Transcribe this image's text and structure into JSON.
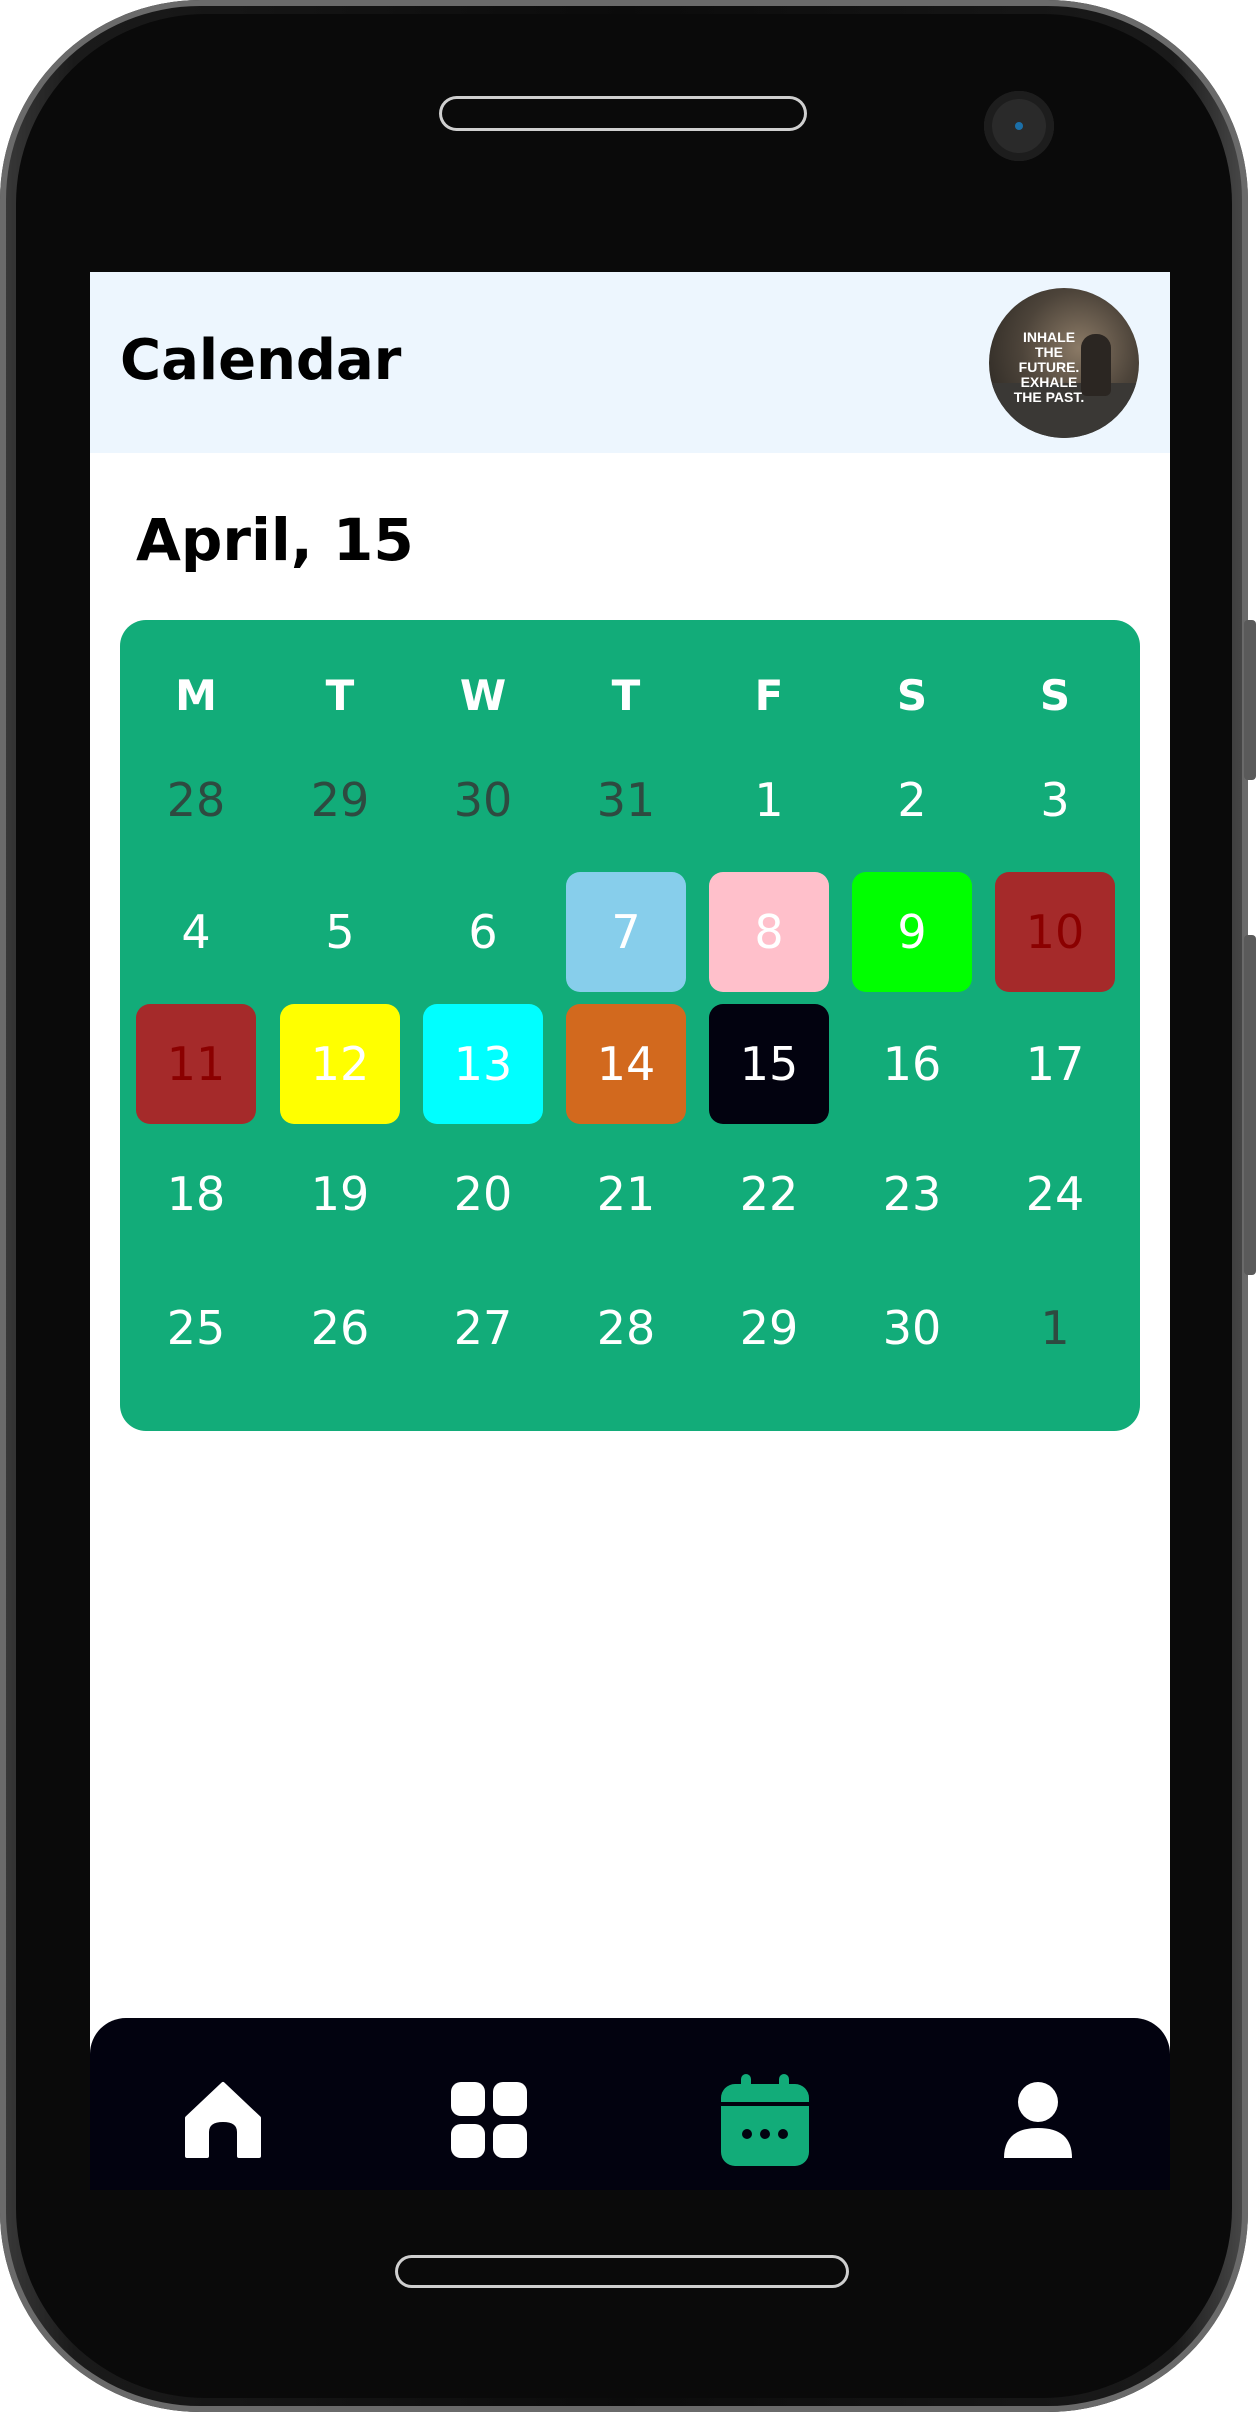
{
  "header": {
    "title": "Calendar",
    "avatar_text": [
      "INHALE",
      "THE FUTURE.",
      "EXHALE",
      "THE PAST."
    ]
  },
  "date_heading": "April, 15",
  "calendar": {
    "weekdays": [
      "M",
      "T",
      "W",
      "T",
      "F",
      "S",
      "S"
    ],
    "accent": "#12ac79",
    "weeks": [
      [
        {
          "d": "28",
          "muted": true
        },
        {
          "d": "29",
          "muted": true
        },
        {
          "d": "30",
          "muted": true
        },
        {
          "d": "31",
          "muted": true
        },
        {
          "d": "1"
        },
        {
          "d": "2"
        },
        {
          "d": "3"
        }
      ],
      [
        {
          "d": "4"
        },
        {
          "d": "5"
        },
        {
          "d": "6"
        },
        {
          "d": "7",
          "bg": "#87ceeb"
        },
        {
          "d": "8",
          "bg": "#ffc0cb"
        },
        {
          "d": "9",
          "bg": "#00ff00"
        },
        {
          "d": "10",
          "bg": "#a52a2a",
          "fg": "#8b0000"
        }
      ],
      [
        {
          "d": "11",
          "bg": "#a52a2a",
          "fg": "#8b0000"
        },
        {
          "d": "12",
          "bg": "#ffff00"
        },
        {
          "d": "13",
          "bg": "#00ffff"
        },
        {
          "d": "14",
          "bg": "#d2691e"
        },
        {
          "d": "15",
          "bg": "#02020f",
          "selected": true
        },
        {
          "d": "16"
        },
        {
          "d": "17"
        }
      ],
      [
        {
          "d": "18"
        },
        {
          "d": "19"
        },
        {
          "d": "20"
        },
        {
          "d": "21"
        },
        {
          "d": "22"
        },
        {
          "d": "23"
        },
        {
          "d": "24"
        }
      ],
      [
        {
          "d": "25"
        },
        {
          "d": "26"
        },
        {
          "d": "27"
        },
        {
          "d": "28"
        },
        {
          "d": "29"
        },
        {
          "d": "30"
        },
        {
          "d": "1",
          "muted": true
        }
      ]
    ]
  },
  "nav": {
    "items": [
      {
        "icon": "home-icon",
        "active": false
      },
      {
        "icon": "grid-icon",
        "active": false
      },
      {
        "icon": "calendar-icon",
        "active": true
      },
      {
        "icon": "profile-icon",
        "active": false
      }
    ],
    "active_color": "#12ac79",
    "inactive_color": "#ffffff"
  }
}
